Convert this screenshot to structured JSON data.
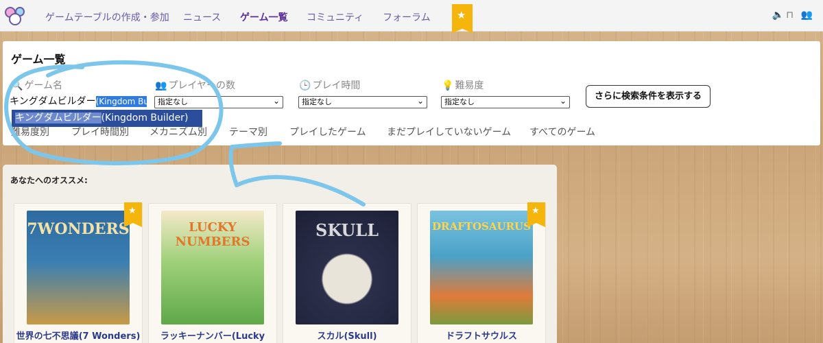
{
  "nav": {
    "items": [
      {
        "label": "ゲームテーブルの作成・参加",
        "active": false
      },
      {
        "label": "ニュース",
        "active": false
      },
      {
        "label": "ゲーム一覧",
        "active": true
      },
      {
        "label": "コミュニティ",
        "active": false
      },
      {
        "label": "フォーラム",
        "active": false
      }
    ],
    "badge_icon": "star-icon",
    "right_icons": [
      "speaker-icon",
      "table-icon",
      "friends-icon"
    ],
    "right_text": "🔈⊓ 👥"
  },
  "search": {
    "title": "ゲーム一覧",
    "fields": {
      "name_label": "ゲーム名",
      "name_value": "キングダムビルダー",
      "name_selected": "(Kingdom Bui",
      "players_label": "プレイヤーの数",
      "players_value": "指定なし",
      "duration_label": "プレイ時間",
      "duration_value": "指定なし",
      "difficulty_label": "難易度",
      "difficulty_value": "指定なし"
    },
    "more_button": "さらに検索条件を表示する",
    "autocomplete": {
      "highlight": "キングダムビルダー",
      "rest": "(Kingdom Builder)"
    },
    "tabs": [
      "難易度別",
      "プレイ時間別",
      "メカニズム別",
      "テーマ別",
      "プレイしたゲーム",
      "まだプレイしていないゲーム",
      "すべてのゲーム"
    ]
  },
  "recommendations": {
    "title": "あなたへのオススメ:",
    "cards": [
      {
        "name": "世界の七不思議(7 Wonders)",
        "cover_text": "7WONDERS",
        "favorite": true,
        "colors": [
          "#2a5c8a",
          "#c79a45"
        ]
      },
      {
        "name": "ラッキーナンバー(Lucky",
        "cover_text": "LUCKY NUMBERS",
        "favorite": false,
        "colors": [
          "#8fc46a",
          "#f4c63b"
        ]
      },
      {
        "name": "スカル(Skull)",
        "cover_text": "SKULL",
        "favorite": false,
        "colors": [
          "#2b2f4a",
          "#a0a0a8"
        ]
      },
      {
        "name": "ドラフトサウルス",
        "cover_text": "DRAFTOSAURUS",
        "favorite": true,
        "colors": [
          "#3aa0c8",
          "#e56a2a"
        ]
      }
    ]
  },
  "annotation_color": "#7cc6ec"
}
